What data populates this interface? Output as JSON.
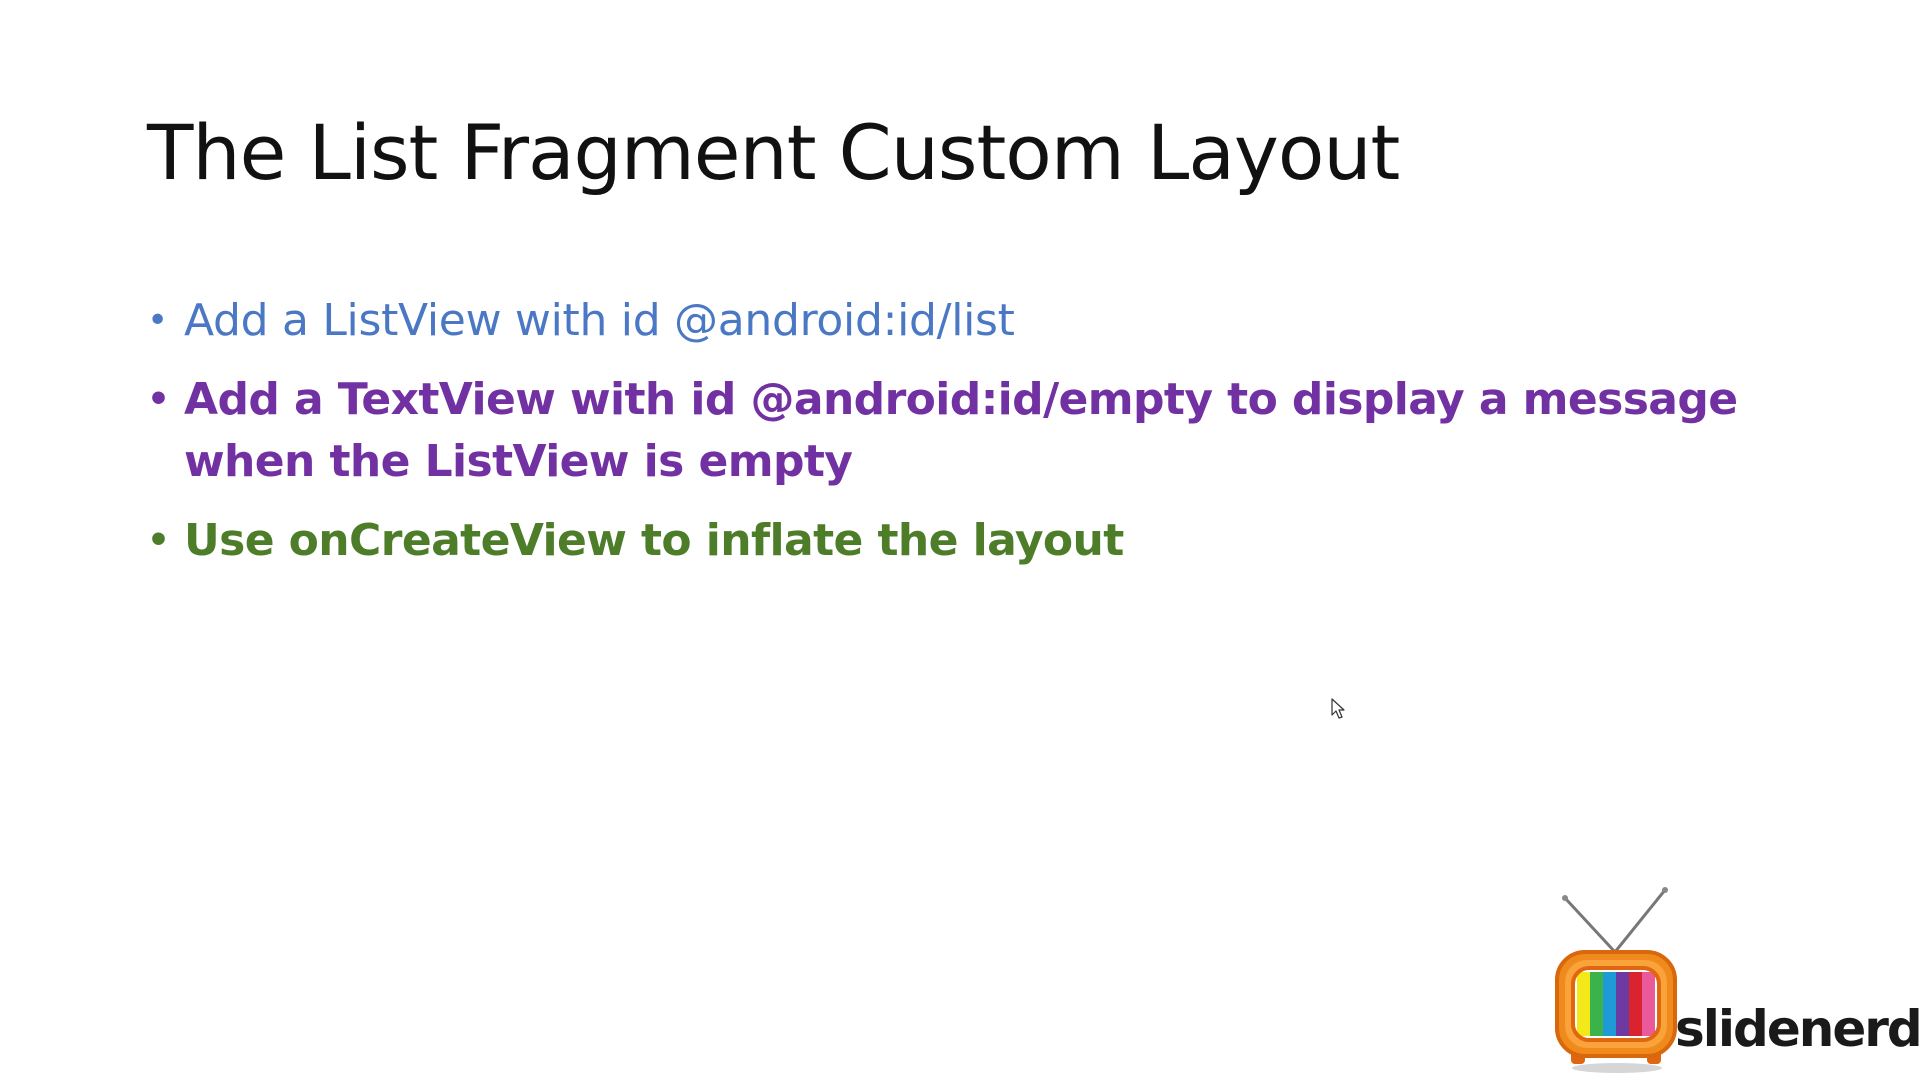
{
  "slide": {
    "title": "The List Fragment Custom Layout",
    "bullets": [
      {
        "text": "Add a ListView with id @android:id/list",
        "color": "#4a78c4",
        "style": "regular"
      },
      {
        "text": "Add a TextView with id @android:id/empty to display a message when the ListView is empty",
        "color": "#7231a2",
        "style": "bold"
      },
      {
        "text": "Use onCreateView to inflate the layout",
        "color": "#4e7d2a",
        "style": "bold"
      }
    ],
    "bullet_glyph": "•"
  },
  "logo": {
    "wordmark": "slidenerd",
    "icon": "tv-icon"
  },
  "cursor": {
    "icon": "mouse-pointer-icon"
  }
}
